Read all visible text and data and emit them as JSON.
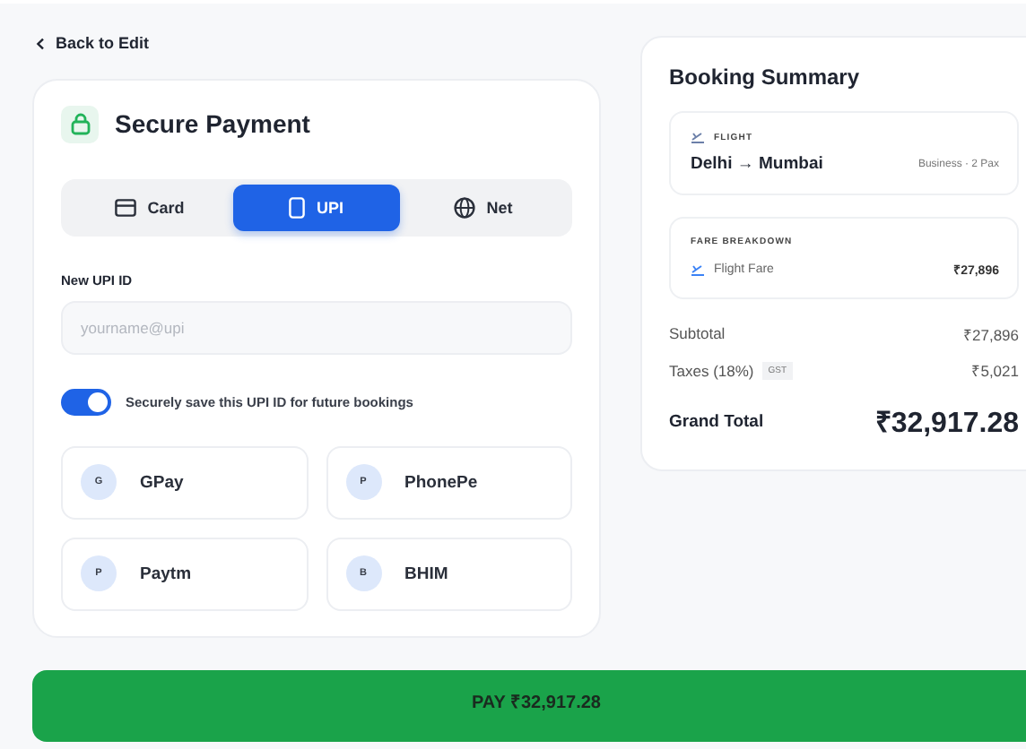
{
  "back_link": {
    "label": "Back to Edit"
  },
  "payment": {
    "title": "Secure Payment",
    "tabs": [
      {
        "label": "Card",
        "kind": "card",
        "selected": false
      },
      {
        "label": "UPI",
        "kind": "phone",
        "selected": true
      },
      {
        "label": "Net",
        "kind": "globe",
        "selected": false
      }
    ],
    "upi_field": {
      "label": "New UPI ID",
      "placeholder": "yourname@upi"
    },
    "save_toggle": {
      "label": "Securely save this UPI ID for future bookings",
      "on": true
    },
    "apps": [
      {
        "initial": "G",
        "name": "GPay"
      },
      {
        "initial": "P",
        "name": "PhonePe"
      },
      {
        "initial": "P",
        "name": "Paytm"
      },
      {
        "initial": "B",
        "name": "BHIM"
      }
    ]
  },
  "summary": {
    "title": "Booking Summary",
    "flight": {
      "label": "FLIGHT",
      "route": "Delhi → Mumbai",
      "details": "Business · 2 Pax"
    },
    "fare": {
      "label": "FARE BREAKDOWN",
      "item": "Flight Fare",
      "amount": "₹27,896"
    },
    "subtotal": {
      "label": "Subtotal",
      "value": "₹27,896"
    },
    "taxes": {
      "label": "Taxes (18%)",
      "badge": "GST",
      "value": "₹5,021"
    },
    "grand_total": {
      "label": "Grand Total",
      "value": "₹32,917.28"
    }
  },
  "pay_button": {
    "label": "PAY ₹32,917.28"
  }
}
